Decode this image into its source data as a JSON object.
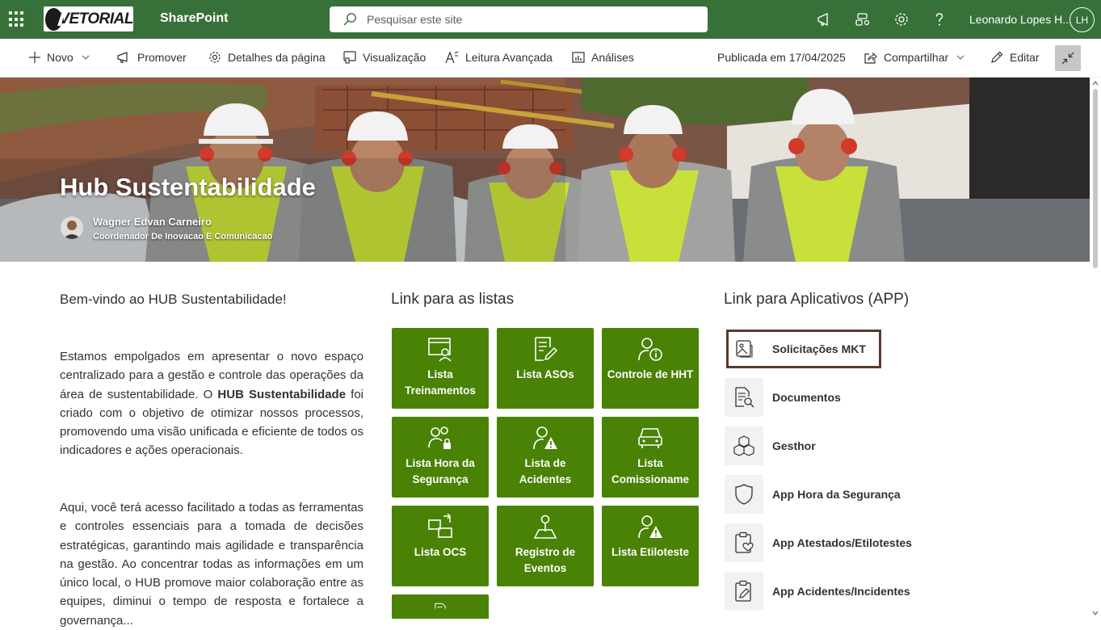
{
  "suite": {
    "brand_text": "VETORIAL",
    "app_name": "SharePoint",
    "search_placeholder": "Pesquisar este site",
    "user_name": "Leonardo Lopes H...",
    "user_initials": "LH",
    "bar_color": "#38703a"
  },
  "commands": {
    "new_label": "Novo",
    "promote_label": "Promover",
    "page_details_label": "Detalhes da página",
    "preview_label": "Visualização",
    "immersive_reader_label": "Leitura Avançada",
    "analytics_label": "Análises",
    "published_text": "Publicada em 17/04/2025",
    "share_label": "Compartilhar",
    "edit_label": "Editar"
  },
  "hero": {
    "title": "Hub Sustentabilidade",
    "author_name": "Wagner Edvan Carneiro",
    "author_role": "Coordenador De Inovacao E Comunicacao"
  },
  "welcome": {
    "title": "Bem-vindo ao HUB Sustentabilidade!",
    "p1_a": "Estamos empolgados em apresentar o novo espaço centralizado para a gestão e controle das operações da área de sustentabilidade. O ",
    "p1_bold": "HUB Sustentabilidade",
    "p1_b": " foi criado com o objetivo de otimizar nossos processos, promovendo uma visão unificada e eficiente de todos os indicadores e ações operacionais.",
    "p2": "Aqui, você terá acesso facilitado a todas as ferramentas e controles essenciais para a tomada de decisões estratégicas, garantindo mais agilidade e transparência na gestão. Ao concentrar todas as informações em um único local, o HUB promove maior colaboração entre as equipes, diminui o tempo de resposta e fortalece a governança..."
  },
  "lists": {
    "title": "Link para as listas",
    "tile_color": "#498205",
    "tiles": [
      {
        "label": "Lista Treinamentos",
        "icon": "training-icon"
      },
      {
        "label": "Lista ASOs",
        "icon": "document-edit-icon"
      },
      {
        "label": "Controle de HHT",
        "icon": "person-info-icon"
      },
      {
        "label": "Lista Hora da Segurança",
        "icon": "people-lock-icon"
      },
      {
        "label": "Lista de Acidentes",
        "icon": "person-warning-icon"
      },
      {
        "label": "Lista Comissioname",
        "icon": "vehicle-icon"
      },
      {
        "label": "Lista OCS",
        "icon": "swap-icon"
      },
      {
        "label": "Registro de Eventos",
        "icon": "map-pin-icon"
      },
      {
        "label": "Lista Etiloteste",
        "icon": "person-alert-icon"
      }
    ]
  },
  "apps": {
    "title": "Link para Aplicativos (APP)",
    "items": [
      {
        "label": "Solicitações MKT",
        "icon": "image-icon"
      },
      {
        "label": "Documentos",
        "icon": "document-search-icon"
      },
      {
        "label": "Gesthor",
        "icon": "cubes-icon"
      },
      {
        "label": "App Hora da Segurança",
        "icon": "shield-icon"
      },
      {
        "label": "App Atestados/Etilotestes",
        "icon": "clipboard-heart-icon"
      },
      {
        "label": "App Acidentes/Incidentes",
        "icon": "clipboard-edit-icon"
      }
    ]
  }
}
